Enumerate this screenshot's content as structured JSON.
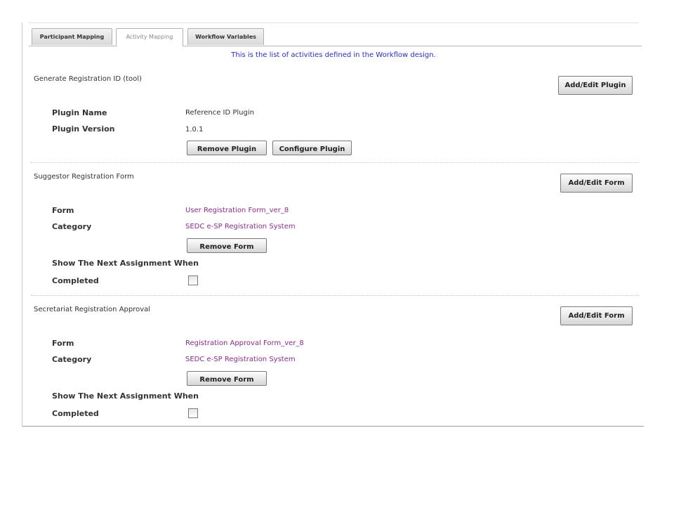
{
  "tabs": [
    {
      "label": "Participant Mapping"
    },
    {
      "label": "Activity Mapping"
    },
    {
      "label": "Workflow Variables"
    }
  ],
  "intro": "This is the list of activities defined in the Workflow design.",
  "activities": [
    {
      "title": "Generate Registration ID (tool)",
      "side_button": "Add/Edit Plugin",
      "fields": [
        {
          "label": "Plugin Name",
          "value": "Reference ID Plugin"
        },
        {
          "label": "Plugin Version",
          "value": "1.0.1"
        }
      ],
      "buttons": [
        "Remove Plugin",
        "Configure Plugin"
      ]
    },
    {
      "title": "Suggestor Registration Form",
      "side_button": "Add/Edit Form",
      "fields": [
        {
          "label": "Form",
          "value": "User Registration Form_ver_8"
        },
        {
          "label": "Category",
          "value": "SEDC e-SP Registration System"
        }
      ],
      "buttons": [
        "Remove Form"
      ],
      "option_label_1": "Show The Next Assignment When",
      "option_label_2": "Completed",
      "checked": false
    },
    {
      "title": "Secretariat Registration Approval",
      "side_button": "Add/Edit Form",
      "fields": [
        {
          "label": "Form",
          "value": "Registration Approval Form_ver_8"
        },
        {
          "label": "Category",
          "value": "SEDC e-SP Registration System"
        }
      ],
      "buttons": [
        "Remove Form"
      ],
      "option_label_1": "Show The Next Assignment When",
      "option_label_2": "Completed",
      "checked": false
    }
  ]
}
